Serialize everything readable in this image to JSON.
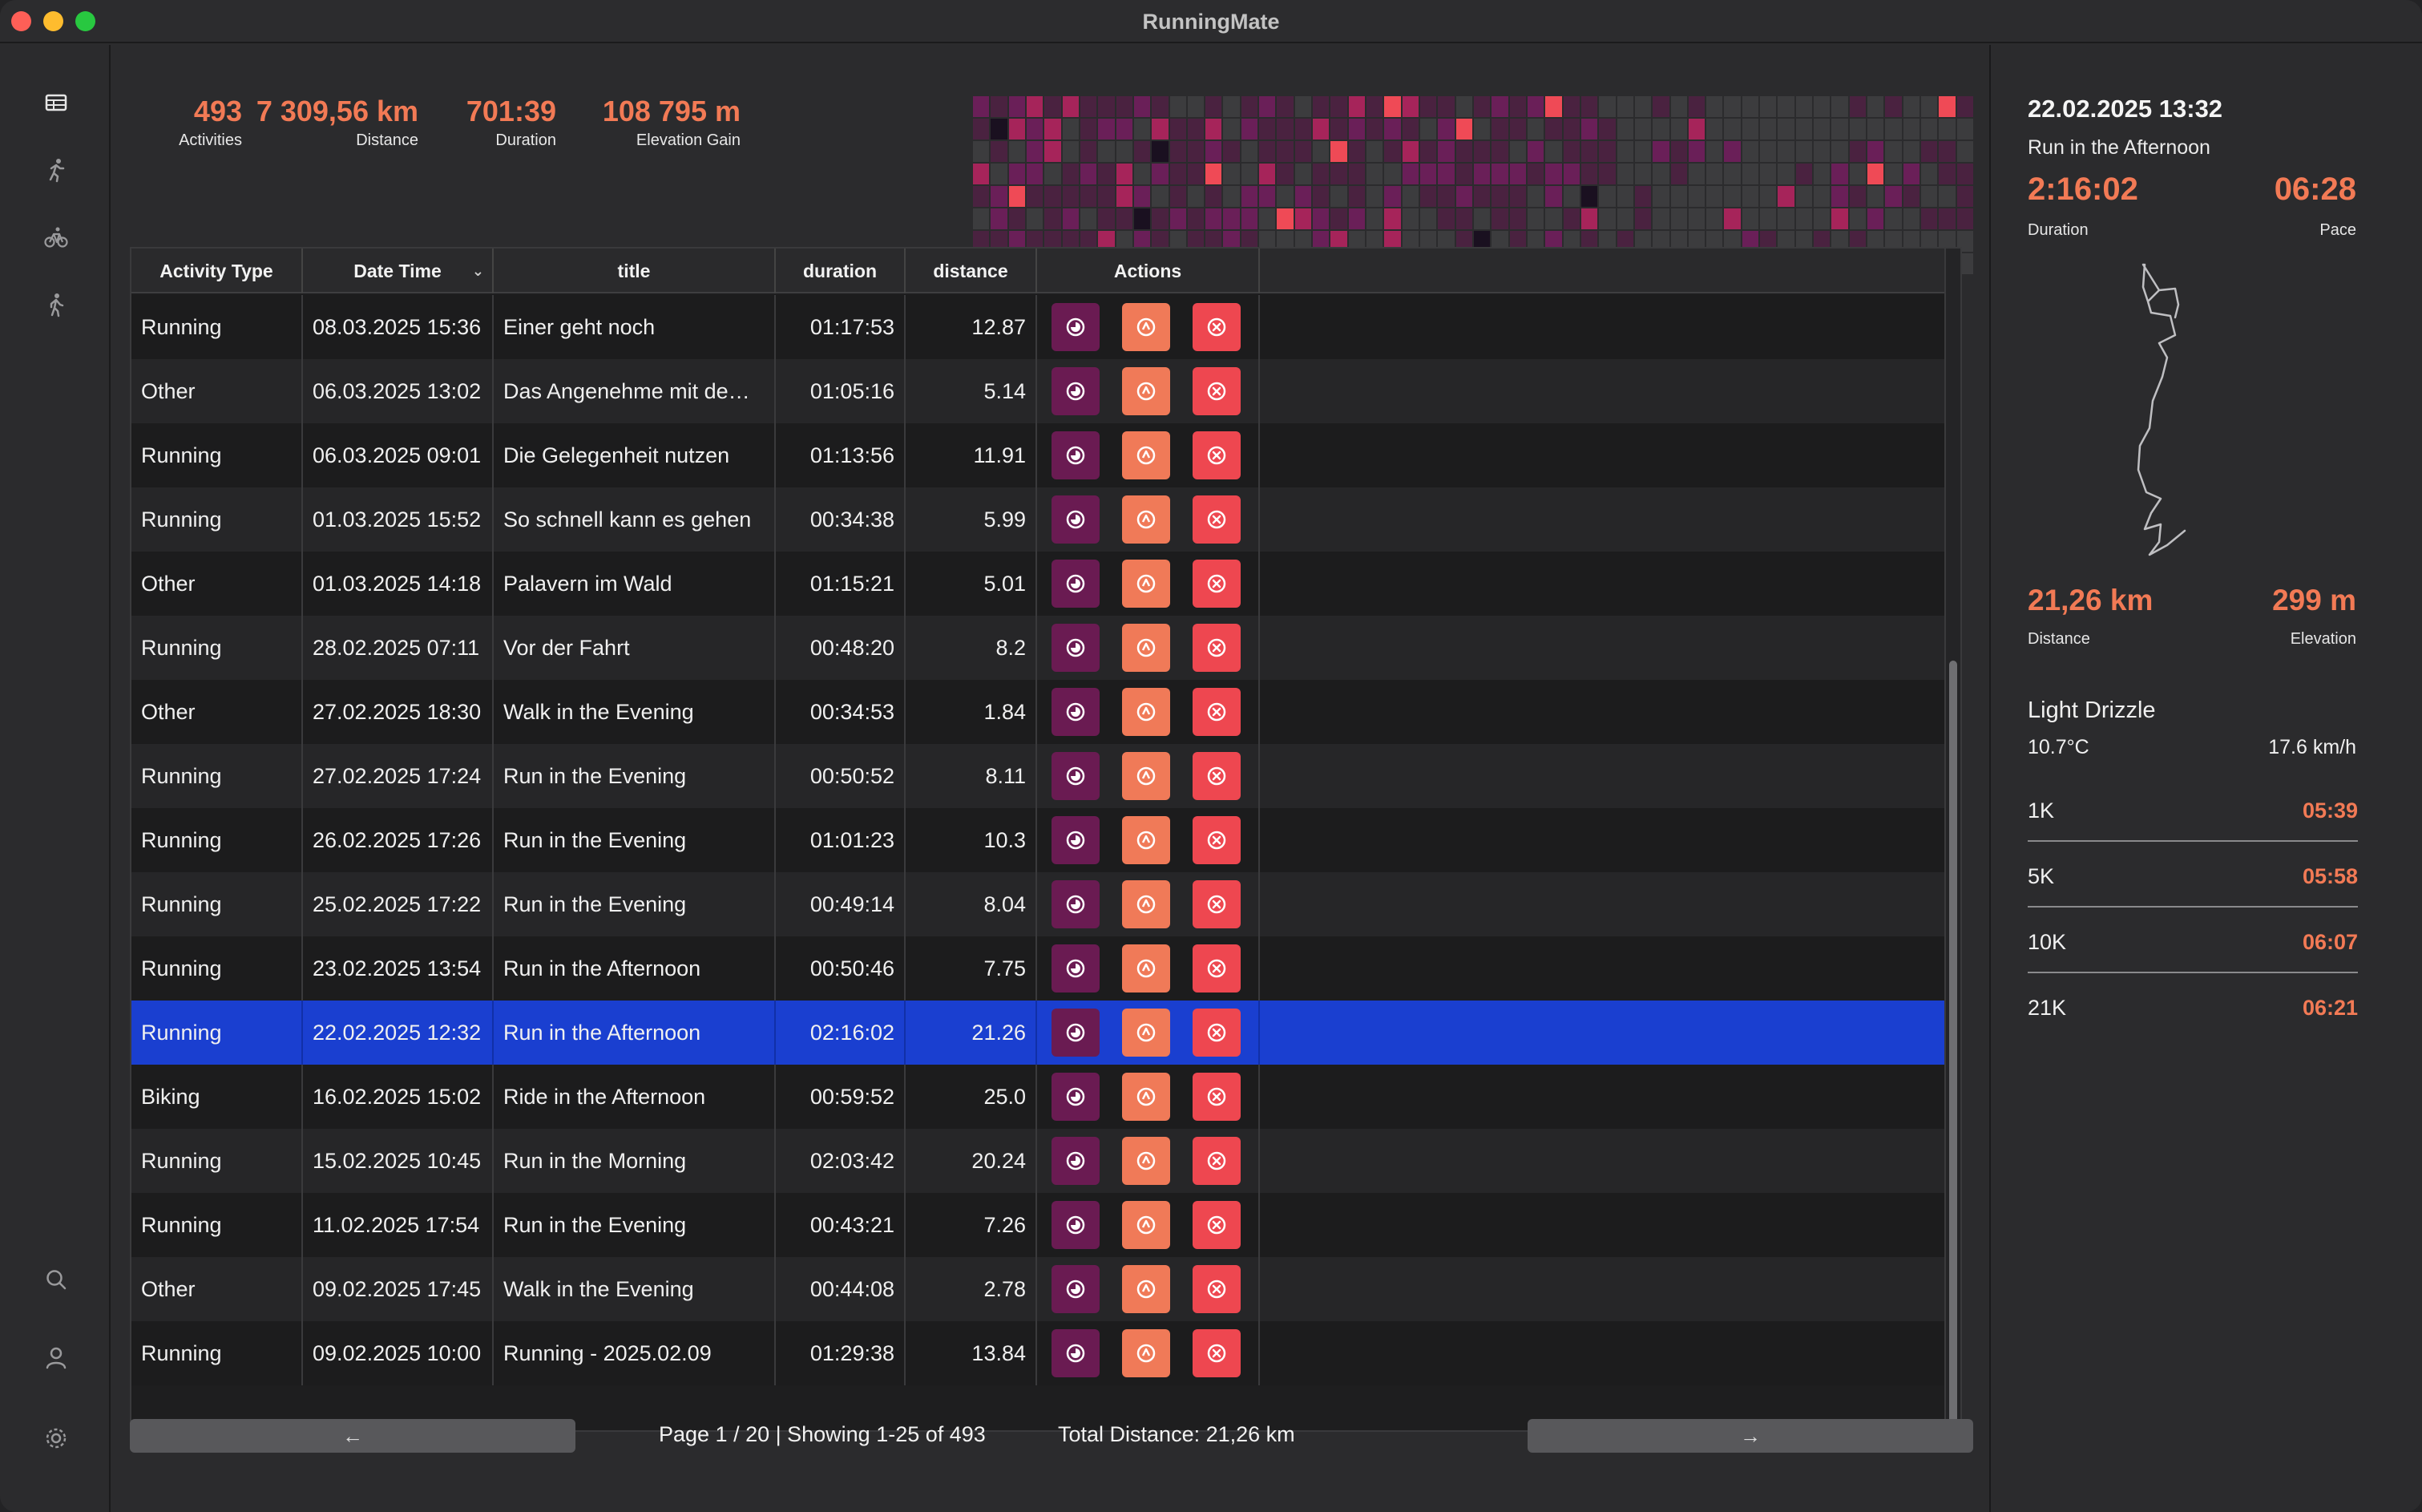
{
  "app": {
    "title": "RunningMate"
  },
  "sidebar": {
    "items": [
      {
        "icon": "table-icon"
      },
      {
        "icon": "running-icon"
      },
      {
        "icon": "bike-icon"
      },
      {
        "icon": "walking-icon"
      },
      {
        "icon": "search-icon"
      },
      {
        "icon": "person-icon"
      },
      {
        "icon": "gear-icon"
      }
    ]
  },
  "stats": [
    {
      "value": "493",
      "label": "Activities"
    },
    {
      "value": "7 309,56 km",
      "label": "Distance"
    },
    {
      "value": "701:39",
      "label": "Duration"
    },
    {
      "value": "108 795 m",
      "label": "Elevation Gain"
    }
  ],
  "heatmap": {
    "colors": {
      "empty": "#3c3c3e",
      "low": "#4a2240",
      "mid": "#6a1f58",
      "high": "#a6245a",
      "max": "#ef4a56",
      "peak": "#f0e6e0",
      "dark": "#1a1020"
    }
  },
  "table": {
    "columns": [
      "Activity Type",
      "Date Time",
      "title",
      "duration",
      "distance",
      "Actions"
    ],
    "sort_column": "Date Time",
    "rows": [
      {
        "type": "Running",
        "date": "08.03.2025 15:36",
        "title": "Einer geht noch",
        "duration": "01:17:53",
        "distance": "12.87"
      },
      {
        "type": "Other",
        "date": "06.03.2025 13:02",
        "title": "Das Angenehme mit dem ...",
        "duration": "01:05:16",
        "distance": "5.14"
      },
      {
        "type": "Running",
        "date": "06.03.2025 09:01",
        "title": "Die Gelegenheit nutzen",
        "duration": "01:13:56",
        "distance": "11.91"
      },
      {
        "type": "Running",
        "date": "01.03.2025 15:52",
        "title": "So schnell kann es gehen",
        "duration": "00:34:38",
        "distance": "5.99"
      },
      {
        "type": "Other",
        "date": "01.03.2025 14:18",
        "title": "Palavern im Wald",
        "duration": "01:15:21",
        "distance": "5.01"
      },
      {
        "type": "Running",
        "date": "28.02.2025 07:11",
        "title": "Vor der Fahrt",
        "duration": "00:48:20",
        "distance": "8.2"
      },
      {
        "type": "Other",
        "date": "27.02.2025 18:30",
        "title": "Walk in the Evening",
        "duration": "00:34:53",
        "distance": "1.84"
      },
      {
        "type": "Running",
        "date": "27.02.2025 17:24",
        "title": "Run in the Evening",
        "duration": "00:50:52",
        "distance": "8.11"
      },
      {
        "type": "Running",
        "date": "26.02.2025 17:26",
        "title": "Run in the Evening",
        "duration": "01:01:23",
        "distance": "10.3"
      },
      {
        "type": "Running",
        "date": "25.02.2025 17:22",
        "title": "Run in the Evening",
        "duration": "00:49:14",
        "distance": "8.04"
      },
      {
        "type": "Running",
        "date": "23.02.2025 13:54",
        "title": "Run in the Afternoon",
        "duration": "00:50:46",
        "distance": "7.75"
      },
      {
        "type": "Running",
        "date": "22.02.2025 12:32",
        "title": "Run in the Afternoon",
        "duration": "02:16:02",
        "distance": "21.26",
        "selected": true
      },
      {
        "type": "Biking",
        "date": "16.02.2025 15:02",
        "title": "Ride in the Afternoon",
        "duration": "00:59:52",
        "distance": "25.0"
      },
      {
        "type": "Running",
        "date": "15.02.2025 10:45",
        "title": "Run in the Morning",
        "duration": "02:03:42",
        "distance": "20.24"
      },
      {
        "type": "Running",
        "date": "11.02.2025 17:54",
        "title": "Run in the Evening",
        "duration": "00:43:21",
        "distance": "7.26"
      },
      {
        "type": "Other",
        "date": "09.02.2025 17:45",
        "title": "Walk in the Evening",
        "duration": "00:44:08",
        "distance": "2.78"
      },
      {
        "type": "Running",
        "date": "09.02.2025 10:00",
        "title": "Running - 2025.02.09",
        "duration": "01:29:38",
        "distance": "13.84"
      }
    ],
    "action_icons": [
      "view-icon",
      "strava-icon",
      "delete-icon"
    ]
  },
  "footer": {
    "prev_label": "←",
    "next_label": "→",
    "page_info": "Page 1 / 20 | Showing 1-25 of 493",
    "total_distance": "Total Distance: 21,26 km"
  },
  "detail": {
    "date": "22.02.2025 13:32",
    "title": "Run in the Afternoon",
    "duration": "2:16:02",
    "duration_label": "Duration",
    "pace": "06:28",
    "pace_label": "Pace",
    "distance": "21,26 km",
    "distance_label": "Distance",
    "elevation": "299 m",
    "elevation_label": "Elevation",
    "weather": "Light Drizzle",
    "temperature": "10.7°C",
    "wind": "17.6 km/h",
    "splits": [
      {
        "label": "1K",
        "time": "05:39"
      },
      {
        "label": "5K",
        "time": "05:58"
      },
      {
        "label": "10K",
        "time": "06:07"
      },
      {
        "label": "21K",
        "time": "06:21"
      }
    ]
  },
  "accent_color": "#f27a55",
  "selection_color": "#1a3fd0"
}
